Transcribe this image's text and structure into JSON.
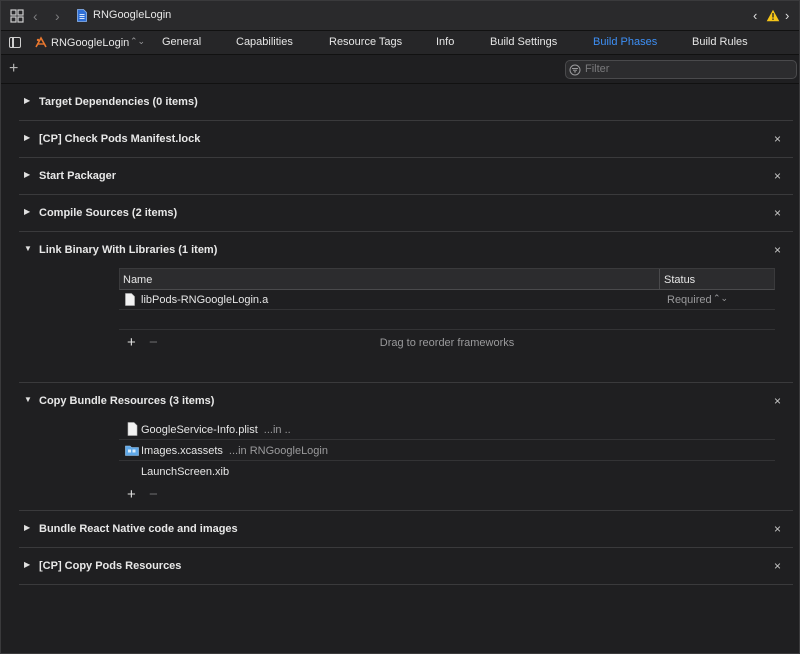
{
  "jumpbar": {
    "title": "RNGoogleLogin"
  },
  "tabbar": {
    "target": "RNGoogleLogin",
    "target_chevron": "⌃",
    "tabs": [
      {
        "label": "General",
        "active": false
      },
      {
        "label": "Capabilities",
        "active": false
      },
      {
        "label": "Resource Tags",
        "active": false
      },
      {
        "label": "Info",
        "active": false
      },
      {
        "label": "Build Settings",
        "active": false
      },
      {
        "label": "Build Phases",
        "active": true
      },
      {
        "label": "Build Rules",
        "active": false
      }
    ]
  },
  "filter": {
    "placeholder": "Filter"
  },
  "phases": [
    {
      "title": "Target Dependencies (0 items)",
      "expanded": false,
      "closable": false
    },
    {
      "title": "[CP] Check Pods Manifest.lock",
      "expanded": false,
      "closable": true
    },
    {
      "title": "Start Packager",
      "expanded": false,
      "closable": true
    },
    {
      "title": "Compile Sources (2 items)",
      "expanded": false,
      "closable": true
    },
    {
      "title": "Link Binary With Libraries (1 item)",
      "expanded": true,
      "closable": true
    },
    {
      "title": "Copy Bundle Resources (3 items)",
      "expanded": true,
      "closable": true
    },
    {
      "title": "Bundle React Native code and images",
      "expanded": false,
      "closable": true
    },
    {
      "title": "[CP] Copy Pods Resources",
      "expanded": false,
      "closable": true
    }
  ],
  "link_binary": {
    "columns": {
      "name": "Name",
      "status": "Status"
    },
    "rows": [
      {
        "name": "libPods-RNGoogleLogin.a",
        "status": "Required"
      }
    ],
    "hint": "Drag to reorder frameworks"
  },
  "copy_bundle": {
    "rows": [
      {
        "name": "GoogleService-Info.plist",
        "location": "...in ..",
        "icon": "file-icon"
      },
      {
        "name": "Images.xcassets",
        "location": "...in RNGoogleLogin",
        "icon": "folder-icon"
      },
      {
        "name": "LaunchScreen.xib",
        "location": "",
        "icon": "none"
      }
    ]
  },
  "symbols": {
    "close": "×",
    "plus": "+",
    "minus": "−",
    "tri_right": "▶",
    "tri_down": "▼"
  },
  "colors": {
    "accent": "#3d8ff5",
    "background": "#1f1f21",
    "warning": "#f5c518"
  }
}
